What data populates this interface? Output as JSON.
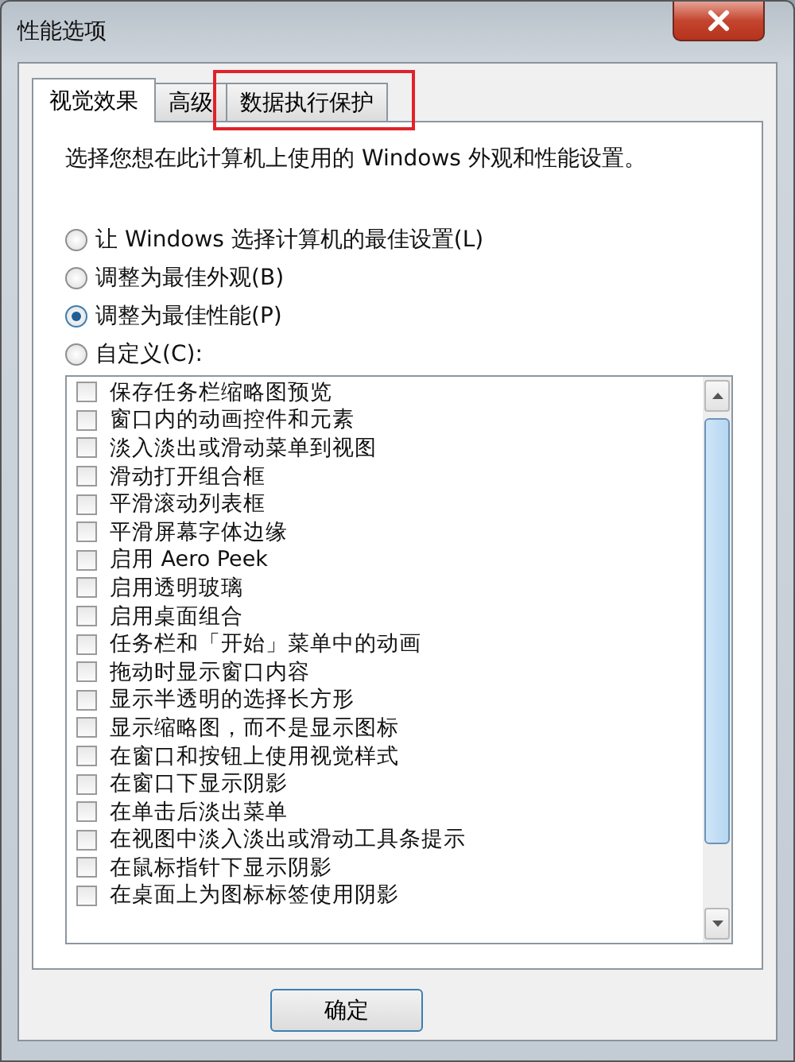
{
  "window": {
    "title": "性能选项"
  },
  "tabs": [
    {
      "label": "视觉效果",
      "selected": true,
      "highlighted": false
    },
    {
      "label": "高级",
      "selected": false,
      "highlighted": false
    },
    {
      "label": "数据执行保护",
      "selected": false,
      "highlighted": true
    }
  ],
  "description": "选择您想在此计算机上使用的 Windows 外观和性能设置。",
  "options": [
    {
      "label": "让 Windows 选择计算机的最佳设置(L)",
      "selected": false
    },
    {
      "label": "调整为最佳外观(B)",
      "selected": false
    },
    {
      "label": "调整为最佳性能(P)",
      "selected": true
    },
    {
      "label": "自定义(C):",
      "selected": false
    }
  ],
  "effects": [
    {
      "label": "保存任务栏缩略图预览",
      "checked": false
    },
    {
      "label": "窗口内的动画控件和元素",
      "checked": false
    },
    {
      "label": "淡入淡出或滑动菜单到视图",
      "checked": false
    },
    {
      "label": "滑动打开组合框",
      "checked": false
    },
    {
      "label": "平滑滚动列表框",
      "checked": false
    },
    {
      "label": "平滑屏幕字体边缘",
      "checked": false
    },
    {
      "label": "启用 Aero Peek",
      "checked": false
    },
    {
      "label": "启用透明玻璃",
      "checked": false
    },
    {
      "label": "启用桌面组合",
      "checked": false
    },
    {
      "label": "任务栏和「开始」菜单中的动画",
      "checked": false
    },
    {
      "label": "拖动时显示窗口内容",
      "checked": false
    },
    {
      "label": "显示半透明的选择长方形",
      "checked": false
    },
    {
      "label": "显示缩略图，而不是显示图标",
      "checked": false
    },
    {
      "label": "在窗口和按钮上使用视觉样式",
      "checked": false
    },
    {
      "label": "在窗口下显示阴影",
      "checked": false
    },
    {
      "label": "在单击后淡出菜单",
      "checked": false
    },
    {
      "label": "在视图中淡入淡出或滑动工具条提示",
      "checked": false
    },
    {
      "label": "在鼠标指针下显示阴影",
      "checked": false
    },
    {
      "label": "在桌面上为图标标签使用阴影",
      "checked": false
    }
  ],
  "buttons": [
    "确定"
  ]
}
